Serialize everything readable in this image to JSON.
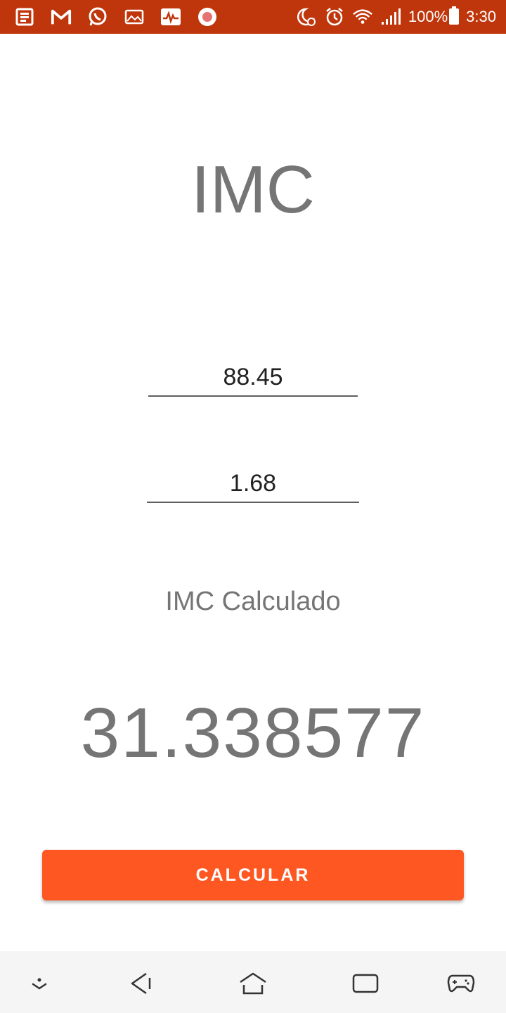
{
  "status_bar": {
    "battery": "100%",
    "time": "3:30",
    "color": "#bf360c",
    "icons_left": [
      "news-icon",
      "gmail-icon",
      "whatsapp-icon",
      "gallery-icon",
      "health-icon",
      "record-icon"
    ],
    "icons_right": [
      "do-not-disturb-icon",
      "alarm-icon",
      "wifi-icon",
      "signal-icon",
      "battery-icon"
    ]
  },
  "main": {
    "title": "IMC",
    "weight_value": "88.45",
    "height_value": "1.68",
    "result_label": "IMC Calculado",
    "result_value": "31.338577",
    "calc_button_label": "CALCULAR",
    "accent_color": "#ff5722",
    "text_color": "#757575"
  },
  "nav_bar": {
    "icons": [
      "expand-icon",
      "back-icon",
      "home-icon",
      "recents-icon",
      "game-icon"
    ]
  }
}
